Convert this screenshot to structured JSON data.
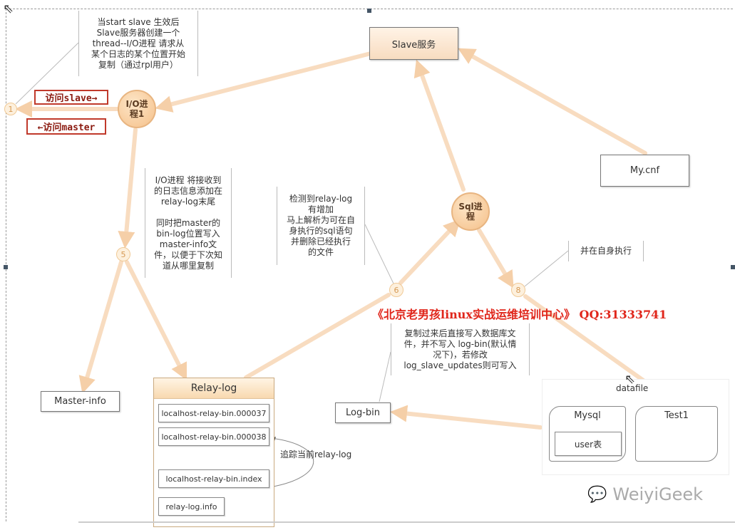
{
  "note_start_slave": "当start slave 生效后\nSlave服务器创建一个\nthread--I/O进程 请求从\n某个日志的某个位置开始\n复制（通过rpl用户）",
  "access_slave": "访问slave→",
  "access_master": "←访问master",
  "io_process": "I/O进\n程1",
  "slave_service": "Slave服务",
  "my_cnf": "My.cnf",
  "sql_process": "Sql进\n程",
  "note_io": "I/O进程 将接收到\n的日志信息添加在\nrelay-log末尾\n\n同时把master的\nbin-log位置写入\nmaster-info文\n件，以便于下次知\n道从哪里复制",
  "note_sql": "检测到relay-log\n有增加\n马上解析为可在自\n身执行的sql语句\n并删除已经执行\n的文件",
  "note_exec": "并在自身执行",
  "steps": [
    "1",
    "5",
    "6",
    "8"
  ],
  "banner": "《北京老男孩linux实战运维培训中心》 QQ:31333741",
  "note_logbin": "复制过来后直接写入数据库文\n件，并不写入 log-bin(默认情\n况下)，若修改\nlog_slave_updates则可写入",
  "master_info": "Master-info",
  "relay_log": {
    "title": "Relay-log",
    "items": [
      "localhost-relay-bin.000037",
      "localhost-relay-bin.000038",
      "localhost-relay-bin.index",
      "relay-log.info"
    ],
    "track_label": "追踪当前relay-log"
  },
  "log_bin": "Log-bin",
  "datafile": {
    "label": "datafile",
    "mysql": "Mysql",
    "user_table": "user表",
    "test1": "Test1"
  },
  "watermark": "WeiyiGeek",
  "colors": {
    "arrow": "#f8dcc0",
    "banner": "#e0261b",
    "label_red": "#8b1a10"
  }
}
